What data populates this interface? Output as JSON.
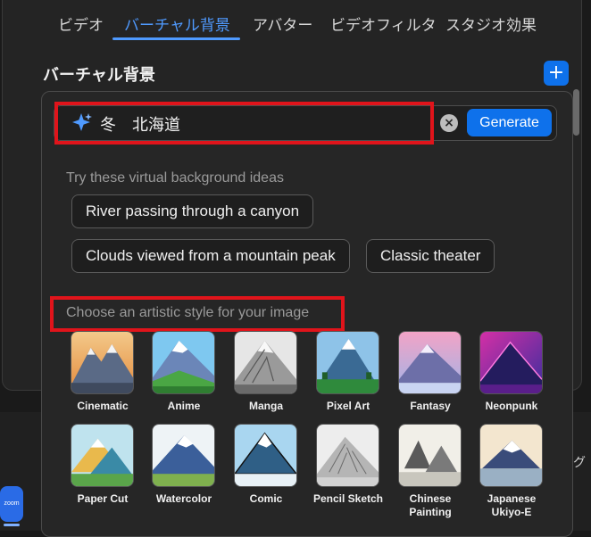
{
  "tabs": [
    {
      "label": "ビデオ"
    },
    {
      "label": "バーチャル背景",
      "active": true
    },
    {
      "label": "アバター"
    },
    {
      "label": "ビデオフィルタ"
    },
    {
      "label": "スタジオ効果"
    }
  ],
  "section": {
    "title": "バーチャル背景",
    "add_label": "+"
  },
  "prompt": {
    "value": "冬　北海道",
    "clear_label": "×",
    "generate_label": "Generate"
  },
  "ideas": {
    "label": "Try these virtual background ideas",
    "chips": [
      "River passing through a canyon",
      "Clouds viewed from a mountain peak",
      "Classic theater"
    ]
  },
  "styles": {
    "label": "Choose an artistic style for your image",
    "items": [
      {
        "label": "Cinematic"
      },
      {
        "label": "Anime"
      },
      {
        "label": "Manga"
      },
      {
        "label": "Pixel Art"
      },
      {
        "label": "Fantasy"
      },
      {
        "label": "Neonpunk"
      },
      {
        "label": "Paper Cut"
      },
      {
        "label": "Watercolor"
      },
      {
        "label": "Comic"
      },
      {
        "label": "Pencil Sketch"
      },
      {
        "label": "Chinese Painting"
      },
      {
        "label": "Japanese Ukiyo-E"
      }
    ]
  },
  "taskbar": {
    "zoom_label": "zoom",
    "edge_text": "グ"
  },
  "colors": {
    "accent": "#0e71eb",
    "highlight": "#e0141b",
    "active_tab": "#4f9aff"
  }
}
